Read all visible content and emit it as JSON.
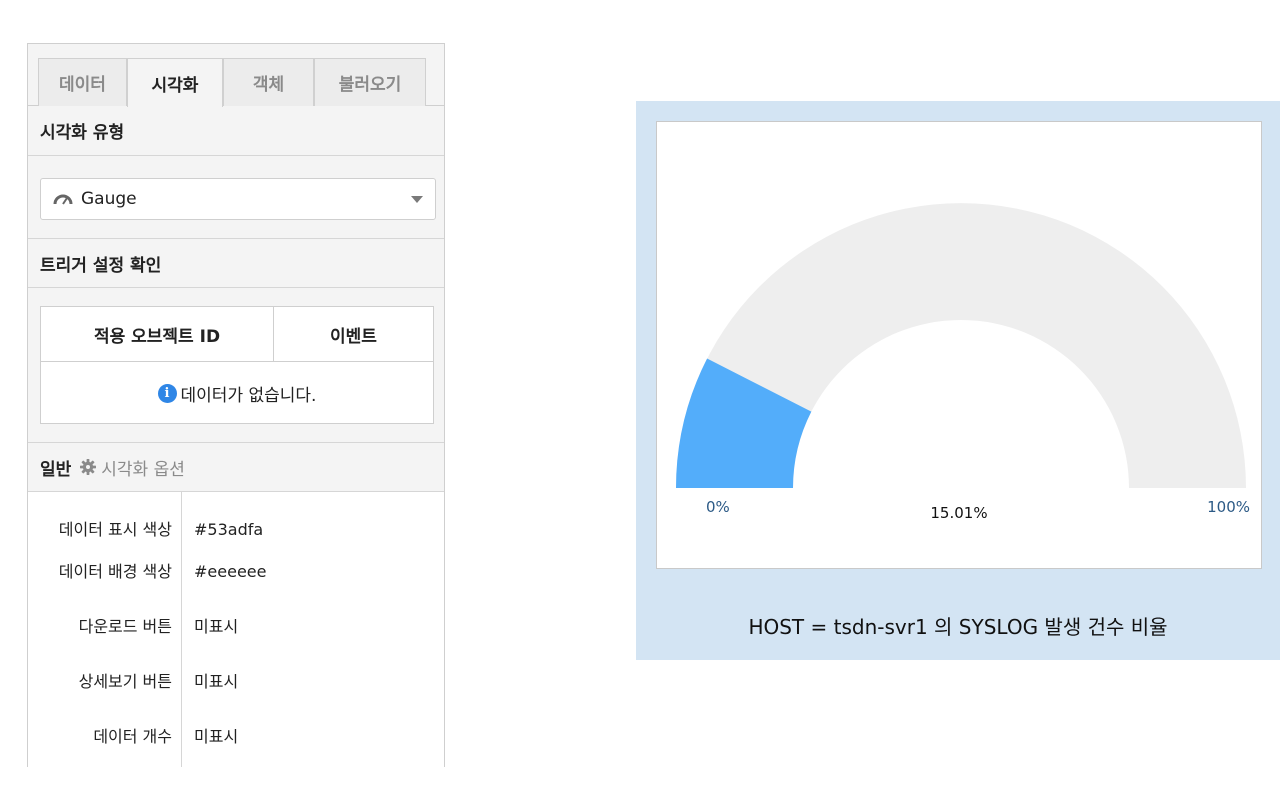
{
  "tabs": [
    {
      "label": "데이터",
      "active": false
    },
    {
      "label": "시각화",
      "active": true
    },
    {
      "label": "객체",
      "active": false
    },
    {
      "label": "불러오기",
      "active": false
    }
  ],
  "viz_type": {
    "header": "시각화 유형",
    "selected": "Gauge",
    "icon": "gauge-icon"
  },
  "trigger": {
    "header": "트리거 설정 확인",
    "columns": [
      "적용 오브젝트 ID",
      "이벤트"
    ],
    "empty_message": "데이터가 없습니다.",
    "empty_icon": "info-icon"
  },
  "general": {
    "header": "일반",
    "options_link": "시각화 옵션",
    "options": [
      {
        "label": "데이터 표시 색상",
        "value": "#53adfa"
      },
      {
        "label": "데이터 배경 색상",
        "value": "#eeeeee"
      },
      {
        "label": "다운로드 버튼",
        "value": "미표시"
      },
      {
        "label": "상세보기 버튼",
        "value": "미표시"
      },
      {
        "label": "데이터 개수",
        "value": "미표시"
      }
    ]
  },
  "widget": {
    "caption": "HOST = tsdn-svr1 의 SYSLOG 발생 건수 비율",
    "min_label": "0%",
    "max_label": "100%",
    "value_label": "15.01%",
    "value_ratio": 0.1501,
    "fill_color": "#53adfa",
    "track_color": "#eeeeee"
  }
}
